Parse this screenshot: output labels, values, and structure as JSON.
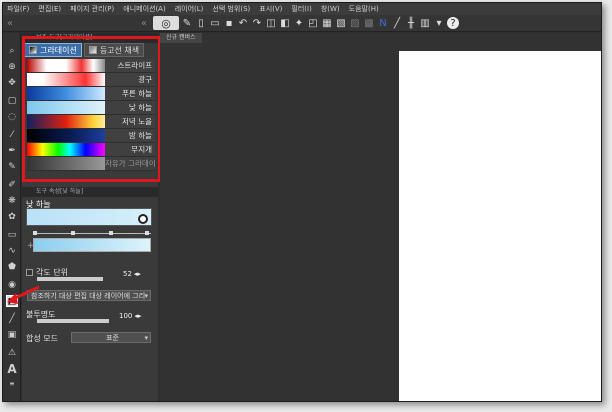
{
  "menubar": {
    "items": [
      "파일(F)",
      "편집(E)",
      "페이지 관리(P)",
      "애니메이션(A)",
      "레이어(L)",
      "선택 범위(S)",
      "표시(V)",
      "필터(I)",
      "창(W)",
      "도움말(H)"
    ]
  },
  "panel": {
    "title": "보조 도구[그라데이션]",
    "tabs": {
      "gradient": "그라데이션",
      "contour": "등고선 채색"
    },
    "gradients": [
      {
        "label": "스트라이프"
      },
      {
        "label": "광구"
      },
      {
        "label": "푸른 하늘"
      },
      {
        "label": "낮 하늘"
      },
      {
        "label": "저녁 노을"
      },
      {
        "label": "밤 하늘"
      },
      {
        "label": "무지개"
      },
      {
        "label": "자유가 그라데이션"
      }
    ]
  },
  "props": {
    "title": "도구 속성[낮 하늘]",
    "gradient_name": "낮 하늘",
    "angle_label": "각도 단위",
    "angle_value": "52",
    "ref_dropdown": "참조하기 대상 편집 대상 레이어에 그리",
    "opacity_label": "불투명도",
    "opacity_value": "100",
    "blend_label": "합성 모드",
    "blend_value": "표준"
  },
  "document": {
    "tab": "신규 캔버스"
  },
  "colors": {
    "highlight": "#e0181e",
    "canvas": "#ffffff"
  }
}
